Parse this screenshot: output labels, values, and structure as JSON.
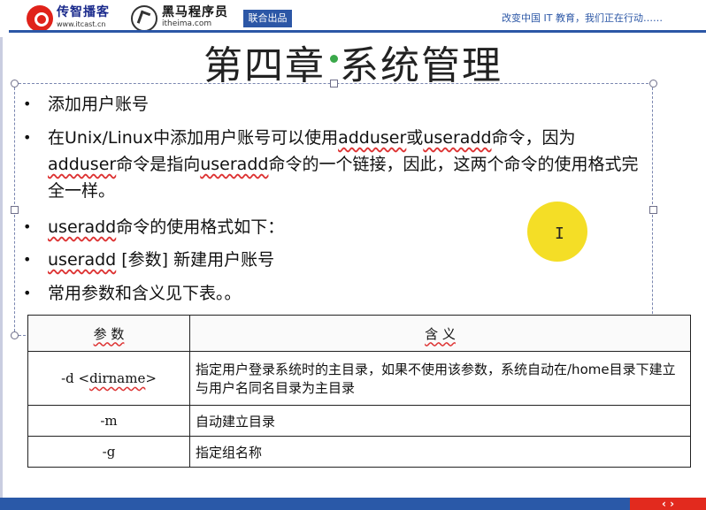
{
  "header": {
    "logo1_name": "传智播客",
    "logo1_url": "www.itcast.cn",
    "logo2_name": "黑马程序员",
    "logo2_url": "itheima.com",
    "joint_badge": "联合出品",
    "slogan": "改变中国 IT 教育，我们正在行动……"
  },
  "slide": {
    "title": "第四章 系统管理",
    "bullets": [
      {
        "text": "添加用户账号"
      },
      {
        "text_pre": "在Unix/Linux中添加用户账号可以使用",
        "cmd1": "adduser",
        "mid1": "或",
        "cmd2": "useradd",
        "mid2": "命令，因为",
        "cmd3": "adduser",
        "mid3": "命令是指向",
        "cmd4": "useradd",
        "post": "命令的一个链接，因此，这两个命令的使用格式完全一样。"
      },
      {
        "cmd": "useradd",
        "post": "命令的使用格式如下："
      },
      {
        "cmd": "useradd",
        "post": " [参数]  新建用户账号"
      },
      {
        "text": "常用参数和含义见下表。。"
      }
    ]
  },
  "table": {
    "headers": [
      "参 数",
      "含 义"
    ],
    "rows": [
      {
        "param_pre": "-d <",
        "param_wavy": "dirname",
        "param_post": ">",
        "desc": "指定用户登录系统时的主目录，如果不使用该参数，系统自动在/home目录下建立与用户名同名目录为主目录"
      },
      {
        "param": "-m",
        "desc": "自动建立目录"
      },
      {
        "param": "-g",
        "desc": "指定组名称"
      }
    ]
  },
  "footer": {
    "nav_label": "‹ ›"
  },
  "colors": {
    "brand_blue": "#2c57a6",
    "brand_red": "#e0221a",
    "highlight_yellow": "#f2d800"
  }
}
